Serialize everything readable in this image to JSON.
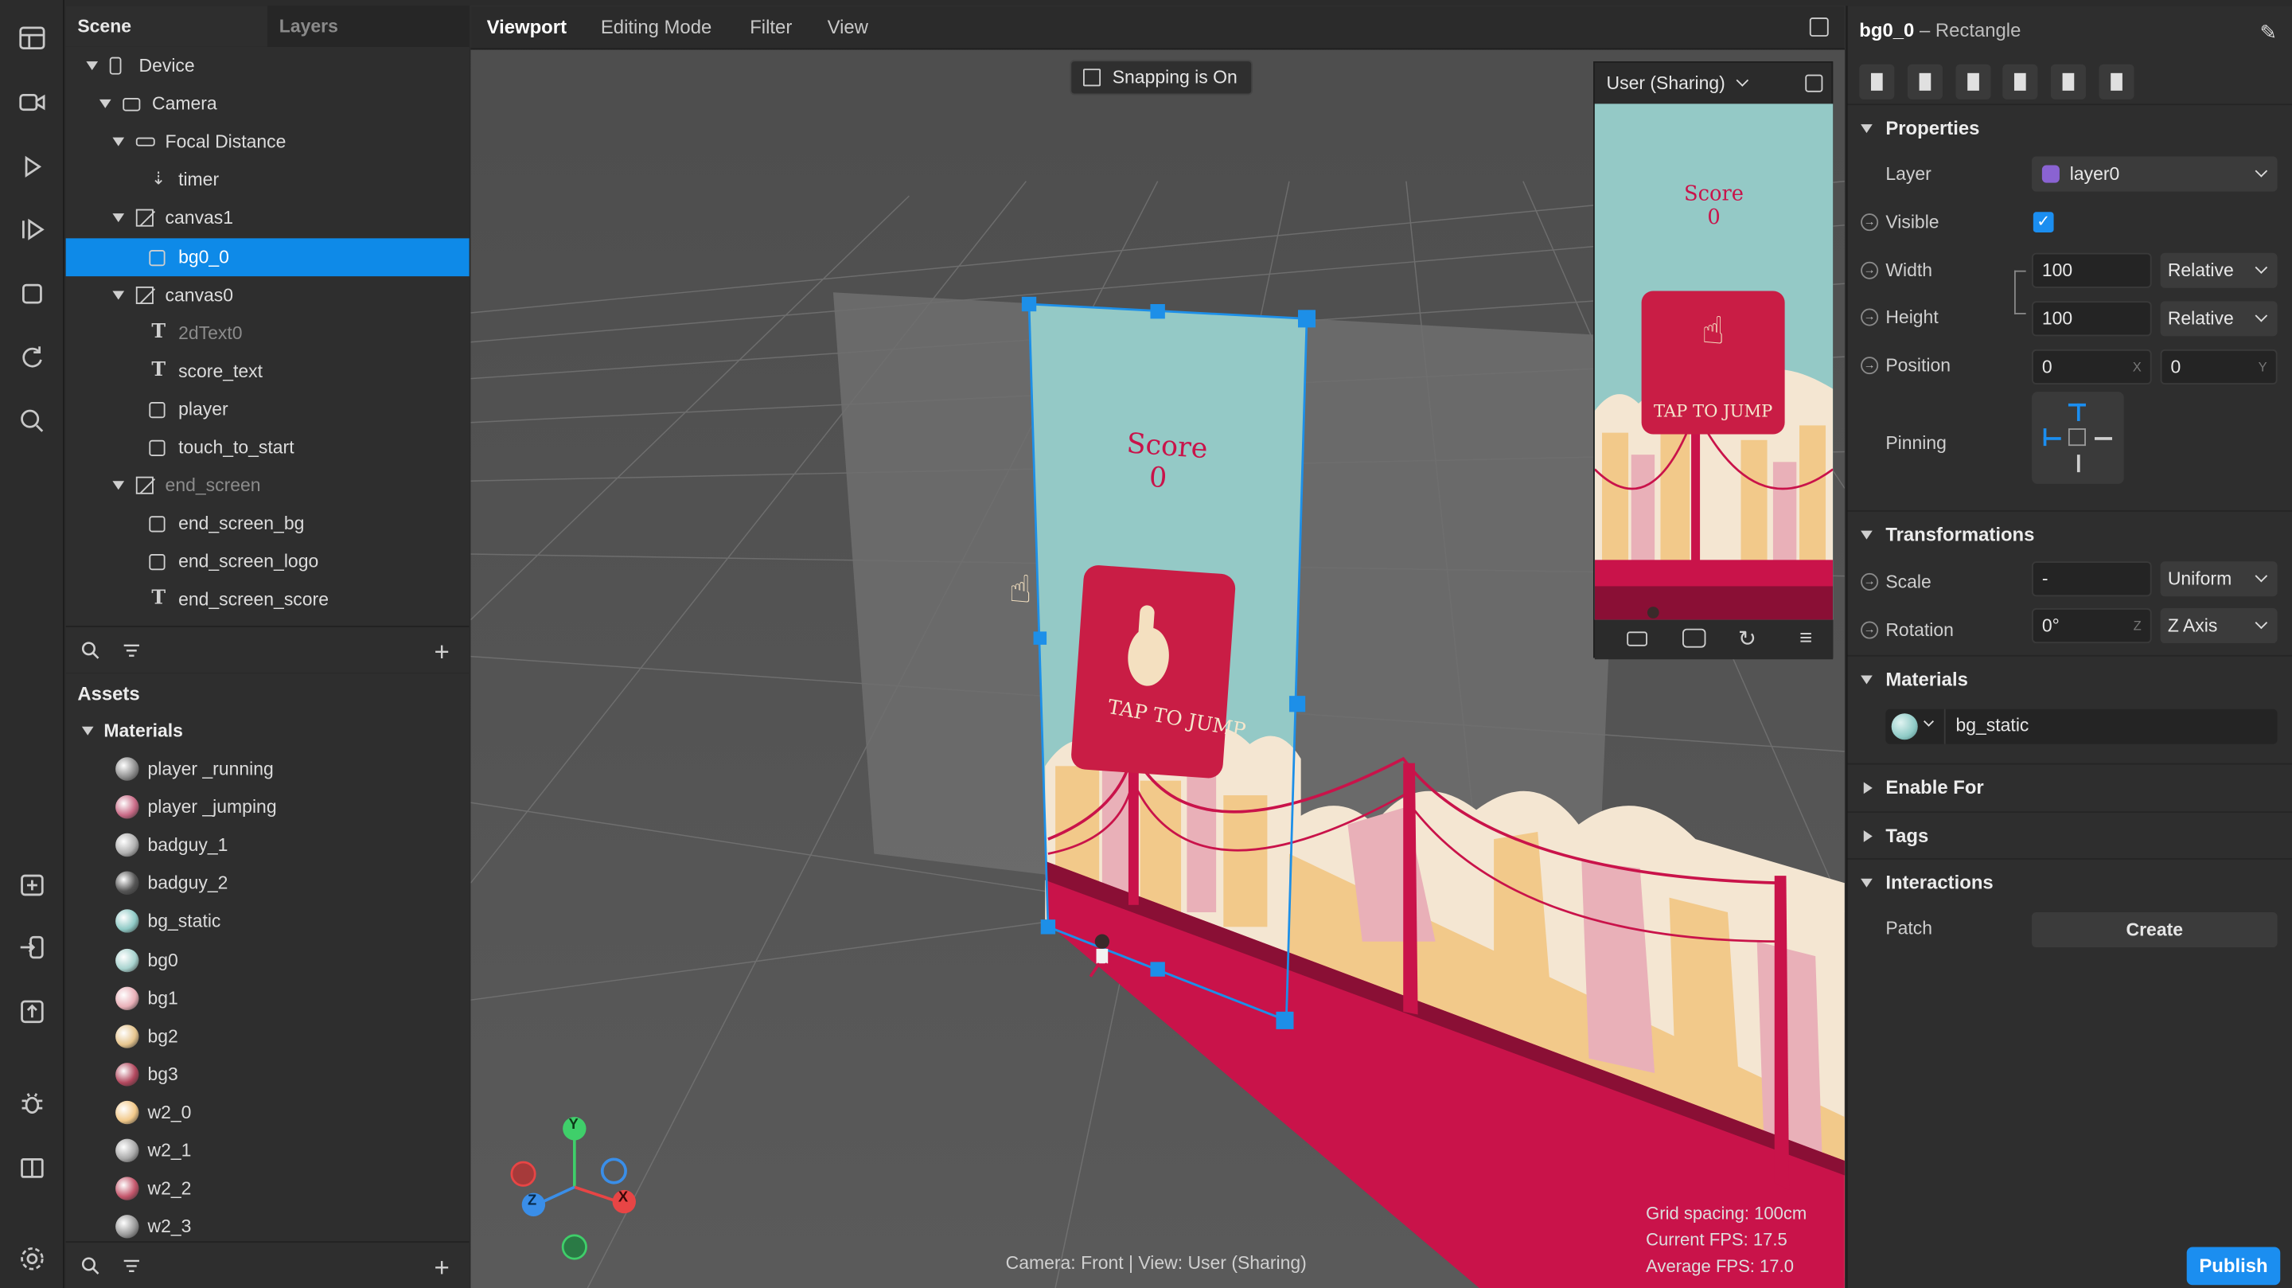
{
  "scene_panel": {
    "tabs": [
      "Scene",
      "Layers"
    ],
    "tree": [
      {
        "label": "Device",
        "depth": 0,
        "icon": "device-icon",
        "expanded": true
      },
      {
        "label": "Camera",
        "depth": 1,
        "icon": "camera-icon",
        "expanded": true
      },
      {
        "label": "Focal Distance",
        "depth": 2,
        "icon": "ruler-icon",
        "expanded": true
      },
      {
        "label": "timer",
        "depth": 3,
        "icon": "timer-icon"
      },
      {
        "label": "canvas1",
        "depth": 2,
        "icon": "canvas-icon",
        "expanded": true
      },
      {
        "label": "bg0_0",
        "depth": 3,
        "icon": "rectangle-icon",
        "selected": true
      },
      {
        "label": "canvas0",
        "depth": 2,
        "icon": "canvas-icon",
        "expanded": true
      },
      {
        "label": "2dText0",
        "depth": 3,
        "icon": "text-icon",
        "dim": true
      },
      {
        "label": "score_text",
        "depth": 3,
        "icon": "text-icon"
      },
      {
        "label": "player",
        "depth": 3,
        "icon": "rectangle-icon"
      },
      {
        "label": "touch_to_start",
        "depth": 3,
        "icon": "rectangle-icon"
      },
      {
        "label": "end_screen",
        "depth": 2,
        "icon": "canvas-icon",
        "expanded": true,
        "dim": true
      },
      {
        "label": "end_screen_bg",
        "depth": 3,
        "icon": "rectangle-icon"
      },
      {
        "label": "end_screen_logo",
        "depth": 3,
        "icon": "rectangle-icon"
      },
      {
        "label": "end_screen_score",
        "depth": 3,
        "icon": "text-icon"
      }
    ]
  },
  "assets_panel": {
    "title": "Assets",
    "group": "Materials",
    "items": [
      {
        "label": "player _running",
        "color": "#8f8f8f"
      },
      {
        "label": "player _jumping",
        "color": "#c96a86"
      },
      {
        "label": "badguy_1",
        "color": "#b0b0b0"
      },
      {
        "label": "badguy_2",
        "color": "#555555"
      },
      {
        "label": "bg_static",
        "color": "#8fcac6"
      },
      {
        "label": "bg0",
        "color": "#a8d3cf"
      },
      {
        "label": "bg1",
        "color": "#e9b0b8"
      },
      {
        "label": "bg2",
        "color": "#e6c58e"
      },
      {
        "label": "bg3",
        "color": "#b2485e"
      },
      {
        "label": "w2_0",
        "color": "#f2c98a"
      },
      {
        "label": "w2_1",
        "color": "#a9a9a9"
      },
      {
        "label": "w2_2",
        "color": "#c4566b"
      },
      {
        "label": "w2_3",
        "color": "#9a9a9a"
      }
    ]
  },
  "viewport": {
    "menu": [
      "Viewport",
      "Editing Mode",
      "Filter",
      "View"
    ],
    "snapping": "Snapping is On",
    "preview_select": "User (Sharing)",
    "score_label": "Score",
    "score_value": "0",
    "tap_label": "TAP TO JUMP",
    "camera_info": "Camera: Front | View: User (Sharing)",
    "stats": {
      "grid": "Grid spacing: 100cm",
      "current_fps": "Current FPS:  17.5",
      "average_fps": "Average FPS:  17.0"
    },
    "gizmo": {
      "y": "Y",
      "x": "X",
      "z": "Z"
    }
  },
  "inspector": {
    "object_name": "bg0_0",
    "object_type": "– Rectangle",
    "sections": {
      "properties": "Properties",
      "transformations": "Transformations",
      "materials": "Materials",
      "enable_for": "Enable For",
      "tags": "Tags",
      "interactions": "Interactions"
    },
    "layer": {
      "label": "Layer",
      "value": "layer0",
      "color": "#8a63d2"
    },
    "visible": {
      "label": "Visible",
      "checked": true
    },
    "width": {
      "label": "Width",
      "value": "100",
      "mode": "Relative"
    },
    "height": {
      "label": "Height",
      "value": "100",
      "mode": "Relative"
    },
    "position": {
      "label": "Position",
      "x": "0",
      "y": "0",
      "x_tag": "X",
      "y_tag": "Y"
    },
    "pinning": {
      "label": "Pinning"
    },
    "scale": {
      "label": "Scale",
      "value": "-",
      "mode": "Uniform"
    },
    "rotation": {
      "label": "Rotation",
      "value": "0°",
      "axis_tag": "Z",
      "mode": "Z Axis"
    },
    "material": {
      "value": "bg_static"
    },
    "patch": {
      "label": "Patch",
      "button": "Create"
    },
    "publish": "Publish"
  }
}
